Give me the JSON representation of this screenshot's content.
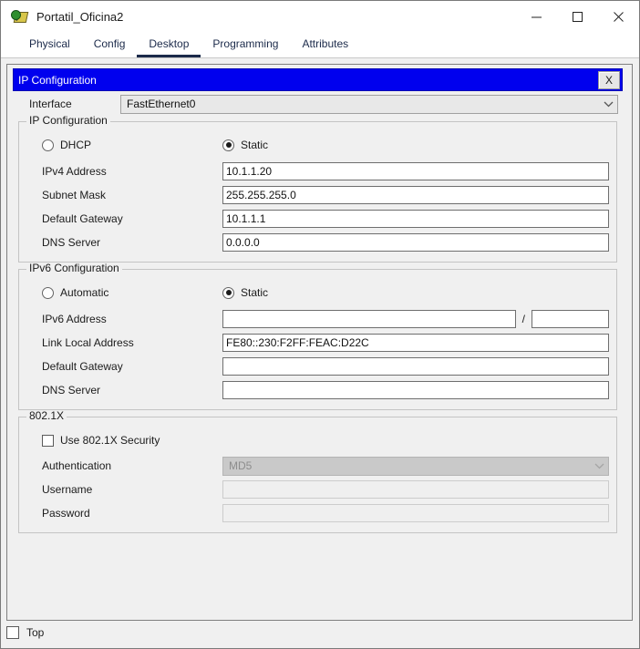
{
  "window": {
    "title": "Portatil_Oficina2",
    "icon": "packet-tracer-icon",
    "controls": {
      "minimize": "—",
      "maximize": "□",
      "close": "✕"
    }
  },
  "tabs": [
    {
      "label": "Physical",
      "active": false
    },
    {
      "label": "Config",
      "active": false
    },
    {
      "label": "Desktop",
      "active": true
    },
    {
      "label": "Programming",
      "active": false
    },
    {
      "label": "Attributes",
      "active": false
    }
  ],
  "ip_configuration": {
    "window_title": "IP Configuration",
    "close_label": "X",
    "interface": {
      "label": "Interface",
      "value": "FastEthernet0",
      "chevron": "⌄"
    },
    "ipv4": {
      "group_title": "IP Configuration",
      "mode_dhcp": "DHCP",
      "mode_static": "Static",
      "selected_mode": "Static",
      "fields": [
        {
          "label": "IPv4 Address",
          "value": "10.1.1.20"
        },
        {
          "label": "Subnet Mask",
          "value": "255.255.255.0"
        },
        {
          "label": "Default Gateway",
          "value": "10.1.1.1"
        },
        {
          "label": "DNS Server",
          "value": "0.0.0.0"
        }
      ]
    },
    "ipv6": {
      "group_title": "IPv6 Configuration",
      "mode_automatic": "Automatic",
      "mode_static": "Static",
      "selected_mode": "Static",
      "address_label": "IPv6 Address",
      "address_value": "",
      "prefix_separator": "/",
      "prefix_value": "",
      "fields": [
        {
          "label": "Link Local Address",
          "value": "FE80::230:F2FF:FEAC:D22C"
        },
        {
          "label": "Default Gateway",
          "value": ""
        },
        {
          "label": "DNS Server",
          "value": ""
        }
      ]
    },
    "dot1x": {
      "group_title": "802.1X",
      "use_security_label": "Use 802.1X Security",
      "use_security_checked": false,
      "authentication_label": "Authentication",
      "authentication_value": "MD5",
      "authentication_chevron": "⌄",
      "username_label": "Username",
      "username_value": "",
      "password_label": "Password",
      "password_value": ""
    }
  },
  "bottom": {
    "top_checkbox_label": "Top",
    "top_checked": false
  },
  "colors": {
    "dialog_titlebar": "#0000ee",
    "window_background": "#f0f0f0",
    "tab_text": "#1b2a4a",
    "field_background": "#ffffff",
    "disabled_background": "#c9c9c9"
  }
}
